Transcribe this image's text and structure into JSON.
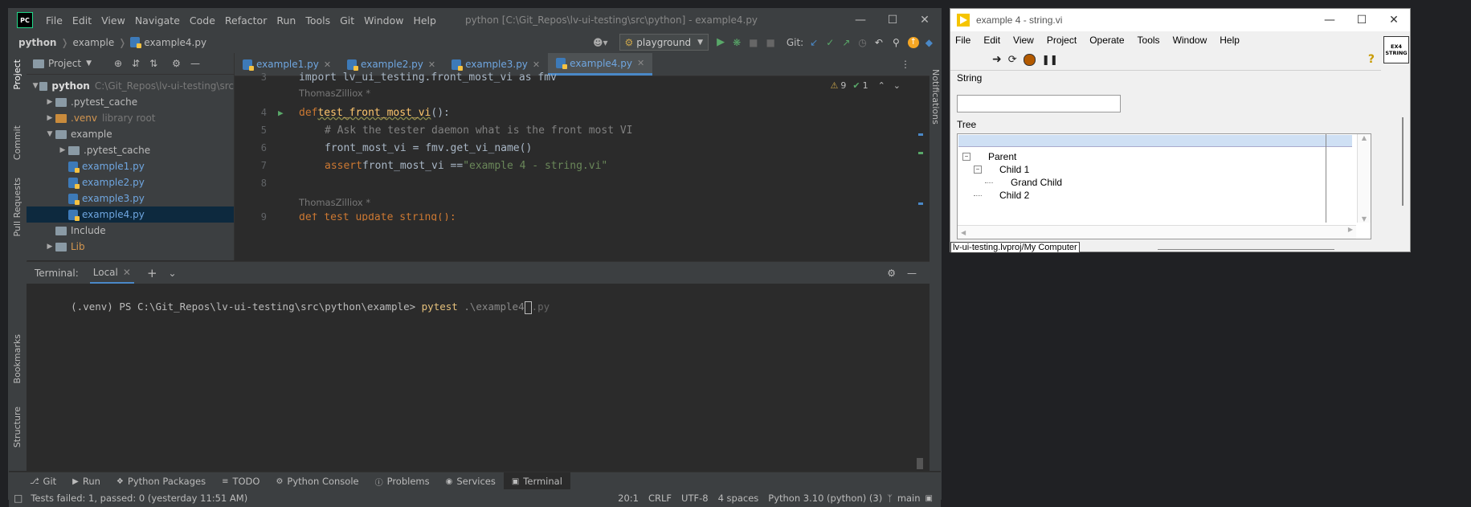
{
  "pycharm": {
    "title": "python [C:\\Git_Repos\\lv-ui-testing\\src\\python] - example4.py",
    "logo": "PC",
    "menu": [
      "File",
      "Edit",
      "View",
      "Navigate",
      "Code",
      "Refactor",
      "Run",
      "Tools",
      "Git",
      "Window",
      "Help"
    ],
    "breadcrumb": [
      "python",
      "example",
      "example4.py"
    ],
    "run_config": "playground",
    "git_label": "Git:",
    "left_strip": [
      "Project",
      "Commit",
      "Pull Requests",
      "Bookmarks",
      "Structure"
    ],
    "right_strip": [
      "Notifications"
    ],
    "project_panel": {
      "title": "Project",
      "tree": [
        {
          "label": "python",
          "note": "C:\\Git_Repos\\lv-ui-testing\\src",
          "kind": "folder",
          "indent": 0,
          "expanded": true
        },
        {
          "label": ".pytest_cache",
          "kind": "folder",
          "indent": 1,
          "expanded": false
        },
        {
          "label": ".venv",
          "note": "library root",
          "kind": "folder",
          "indent": 1,
          "expanded": false
        },
        {
          "label": "example",
          "kind": "folder",
          "indent": 1,
          "expanded": true
        },
        {
          "label": ".pytest_cache",
          "kind": "folder",
          "indent": 2,
          "expanded": false
        },
        {
          "label": "example1.py",
          "kind": "py",
          "indent": 2
        },
        {
          "label": "example2.py",
          "kind": "py",
          "indent": 2
        },
        {
          "label": "example3.py",
          "kind": "py",
          "indent": 2
        },
        {
          "label": "example4.py",
          "kind": "py",
          "indent": 2,
          "selected": true
        },
        {
          "label": "Include",
          "kind": "folder",
          "indent": 1
        },
        {
          "label": "Lib",
          "kind": "folder",
          "indent": 1,
          "expanded": false
        }
      ]
    },
    "tabs": [
      "example1.py",
      "example2.py",
      "example3.py",
      "example4.py"
    ],
    "active_tab": "example4.py",
    "inspection": {
      "warnings": "9",
      "ok": "1"
    },
    "code": {
      "line1": "import lv_ui_testing.front_most_vi as fmv",
      "author1": "ThomasZilliox *",
      "line4_kw": "def ",
      "line4_fn": "test_front_most_vi",
      "line4_rest": "():",
      "line5": "# Ask the tester daemon what is the front most VI",
      "line6": "front_most_vi = fmv.get_vi_name()",
      "line7_kw": "assert ",
      "line7_mid": "front_most_vi == ",
      "line7_str": "\"example 4 - string.vi\"",
      "author2": "ThomasZilliox *",
      "line9": "def test_update_string():",
      "line_numbers": [
        "3",
        "4",
        "5",
        "6",
        "7",
        "8",
        "9"
      ]
    },
    "terminal": {
      "label": "Terminal:",
      "tab": "Local",
      "prompt": "(.venv) PS C:\\Git_Repos\\lv-ui-testing\\src\\python\\example> ",
      "cmd": "pytest",
      "arg": " .\\example4",
      "arg_ghost": ".py"
    },
    "bottom_tabs": [
      "Git",
      "Run",
      "Python Packages",
      "TODO",
      "Python Console",
      "Problems",
      "Services",
      "Terminal"
    ],
    "active_bottom_tab": "Terminal",
    "status": {
      "message": "Tests failed: 1, passed: 0 (yesterday 11:51 AM)",
      "position": "20:1",
      "line_ending": "CRLF",
      "encoding": "UTF-8",
      "indent": "4 spaces",
      "interpreter": "Python 3.10 (python) (3)",
      "branch": "main"
    }
  },
  "labview": {
    "title": "example 4 - string.vi",
    "menu": [
      "File",
      "Edit",
      "View",
      "Project",
      "Operate",
      "Tools",
      "Window",
      "Help"
    ],
    "icon_text": "EX4 STRING",
    "string_label": "String",
    "string_value": "",
    "tree_label": "Tree",
    "tree": [
      {
        "label": "Parent",
        "indent": 0,
        "exp": "⊟"
      },
      {
        "label": "Child 1",
        "indent": 1,
        "exp": "⊟"
      },
      {
        "label": "Grand Child",
        "indent": 2,
        "exp": ""
      },
      {
        "label": "Child 2",
        "indent": 1,
        "exp": ""
      }
    ],
    "status": "lv-ui-testing.lvproj/My Computer"
  }
}
